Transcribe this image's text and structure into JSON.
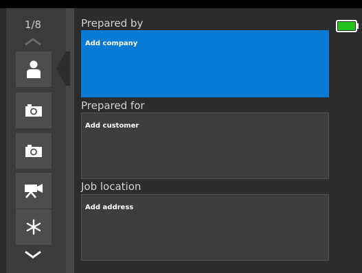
{
  "page_indicator": "1/8",
  "sections": [
    {
      "label": "Prepared by",
      "field_text": "Add company"
    },
    {
      "label": "Prepared for",
      "field_text": "Add customer"
    },
    {
      "label": "Job location",
      "field_text": "Add address"
    }
  ],
  "sidebar": {
    "items": [
      {
        "icon": "person-icon",
        "selected": true
      },
      {
        "icon": "camera-icon"
      },
      {
        "icon": "camera-icon"
      },
      {
        "icon": "video-camera-icon"
      },
      {
        "icon": "asterisk-icon"
      }
    ]
  },
  "battery": {
    "level": 1.0,
    "color": "#22c21a"
  },
  "colors": {
    "active_field": "#0a7bd4",
    "inactive_field": "#3b3e3b"
  }
}
